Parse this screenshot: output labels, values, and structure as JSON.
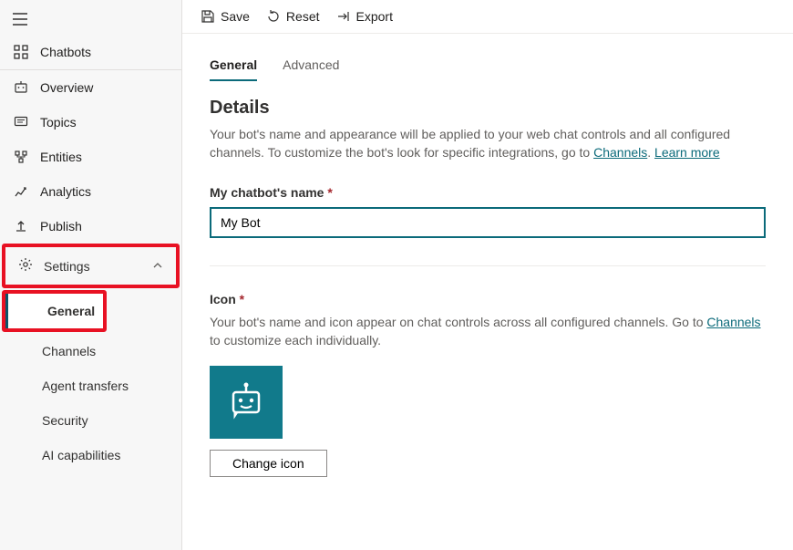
{
  "sidebar": {
    "chatbots": "Chatbots",
    "overview": "Overview",
    "topics": "Topics",
    "entities": "Entities",
    "analytics": "Analytics",
    "publish": "Publish",
    "settings": "Settings",
    "sub": {
      "general": "General",
      "channels": "Channels",
      "agent_transfers": "Agent transfers",
      "security": "Security",
      "ai_capabilities": "AI capabilities"
    }
  },
  "toolbar": {
    "save": "Save",
    "reset": "Reset",
    "export": "Export"
  },
  "tabs": {
    "general": "General",
    "advanced": "Advanced"
  },
  "details": {
    "heading": "Details",
    "description_pre": "Your bot's name and appearance will be applied to your web chat controls and all configured channels. To customize the bot's look for specific integrations, go to ",
    "channels_link": "Channels",
    "separator": ". ",
    "learn_more": "Learn more",
    "name_label": "My chatbot's name",
    "name_value": "My Bot"
  },
  "icon": {
    "label": "Icon",
    "description_pre": "Your bot's name and icon appear on chat controls across all configured channels. Go to ",
    "channels_link": "Channels",
    "description_post": " to customize each individually.",
    "change_button": "Change icon"
  }
}
